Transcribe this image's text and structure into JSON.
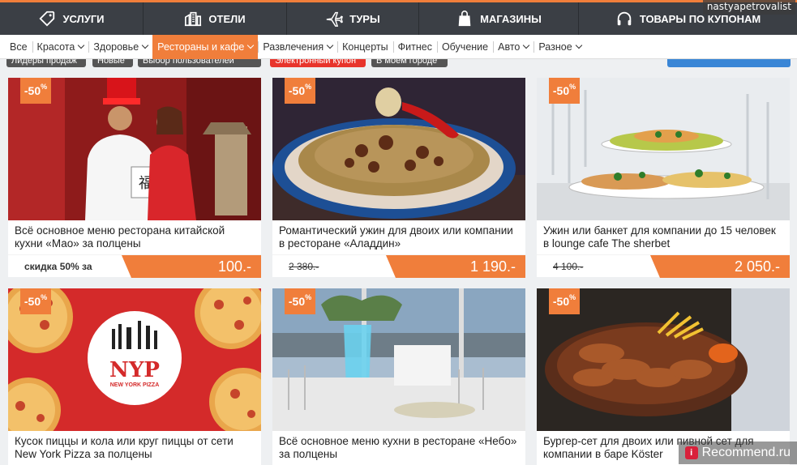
{
  "topnav": {
    "items": [
      {
        "label": "УСЛУГИ",
        "icon": "tag-icon"
      },
      {
        "label": "ОТЕЛИ",
        "icon": "hotel-icon"
      },
      {
        "label": "ТУРЫ",
        "icon": "airplane-icon"
      },
      {
        "label": "МАГАЗИНЫ",
        "icon": "shopping-bag-icon"
      },
      {
        "label": "ТОВАРЫ ПО КУПОНАМ",
        "icon": "headphones-icon"
      }
    ]
  },
  "watermark_top": "nastyapetrovalist",
  "subnav": {
    "items": [
      {
        "label": "Все"
      },
      {
        "label": "Красота",
        "dropdown": true
      },
      {
        "label": "Здоровье",
        "dropdown": true
      },
      {
        "label": "Рестораны и кафе",
        "dropdown": true,
        "active": true
      },
      {
        "label": "Развлечения",
        "dropdown": true
      },
      {
        "label": "Концерты"
      },
      {
        "label": "Фитнес"
      },
      {
        "label": "Обучение"
      },
      {
        "label": "Авто",
        "dropdown": true
      },
      {
        "label": "Разное",
        "dropdown": true
      }
    ]
  },
  "filters": [
    "Лидеры продаж",
    "Новые",
    "Выбор пользователей",
    "Электронный купон",
    "В моем городе"
  ],
  "cards": [
    {
      "badge": "-50",
      "badge_unit": "%",
      "title": "Всё основное меню ресторана китайской кухни «Мао» за полцены",
      "note": "скидка 50% за",
      "old_price": "",
      "price": "100.-",
      "image": "chinese-chef-photo"
    },
    {
      "badge": "-50",
      "badge_unit": "%",
      "title": "Романтический ужин для двоих или компании в ресторане «Аладдин»",
      "note": "",
      "old_price": "2 380.-",
      "price": "1 190.-",
      "image": "pilaf-dish-photo"
    },
    {
      "badge": "-50",
      "badge_unit": "%",
      "title": "Ужин или банкет для компании до 15 человек в lounge cafe The sherbet",
      "note": "",
      "old_price": "4 100.-",
      "price": "2 050.-",
      "image": "banquet-table-photo"
    },
    {
      "badge": "-50",
      "badge_unit": "%",
      "title": "Кусок пиццы и кола или круг пиццы от сети New York Pizza за полцены",
      "note": "",
      "old_price": "",
      "price": "",
      "image": "pizza-photo",
      "logo_text": "NYP",
      "logo_subtext": "NEW YORK PIZZA"
    },
    {
      "badge": "-50",
      "badge_unit": "%",
      "title": "Всё основное меню кухни в ресторане «Небо» за полцены",
      "note": "",
      "old_price": "",
      "price": "",
      "image": "restaurant-interior-photo"
    },
    {
      "badge": "-50",
      "badge_unit": "%",
      "title": "Бургер-сет для двоих или пивной сет для компании в баре Köster",
      "note": "",
      "old_price": "",
      "price": "",
      "image": "chicken-wings-photo"
    }
  ],
  "watermark_bottom": {
    "logo": "i",
    "text": "Recommend.ru"
  },
  "colors": {
    "accent": "#f07e3b",
    "nav_bg": "#3b3f45"
  }
}
